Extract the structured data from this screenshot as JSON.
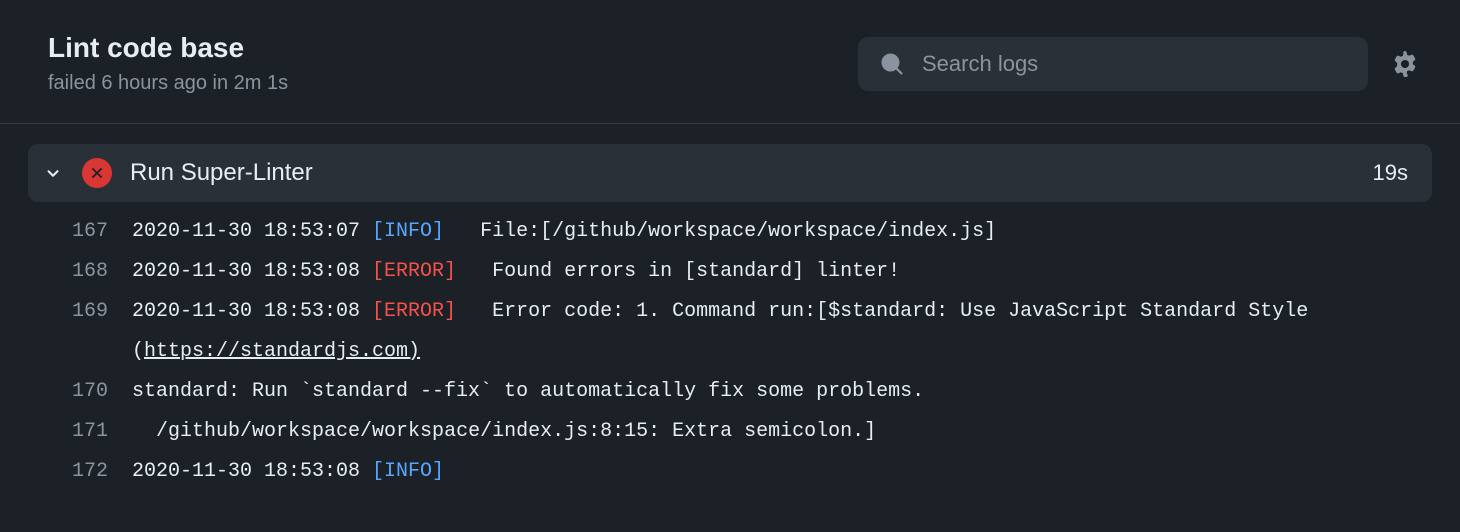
{
  "header": {
    "title": "Lint code base",
    "subtitle": "failed 6 hours ago in 2m 1s",
    "search_placeholder": "Search logs"
  },
  "step": {
    "title": "Run Super-Linter",
    "duration": "19s"
  },
  "log": {
    "lines": [
      {
        "n": "167",
        "ts": "2020-11-30 18:53:07",
        "level": "INFO",
        "msg": "   File:[/github/workspace/workspace/index.js]"
      },
      {
        "n": "168",
        "ts": "2020-11-30 18:53:08",
        "level": "ERROR",
        "msg": "   Found errors in [standard] linter!"
      },
      {
        "n": "169",
        "ts": "2020-11-30 18:53:08",
        "level": "ERROR",
        "msg": "   Error code: 1. Command run:[$standard: Use JavaScript Standard Style (",
        "link": "https://standardjs.com)"
      },
      {
        "n": "170",
        "raw": "standard: Run `standard --fix` to automatically fix some problems."
      },
      {
        "n": "171",
        "raw": "  /github/workspace/workspace/index.js:8:15: Extra semicolon.]"
      },
      {
        "n": "172",
        "ts": "2020-11-30 18:53:08",
        "level": "INFO",
        "msg": ""
      }
    ]
  }
}
